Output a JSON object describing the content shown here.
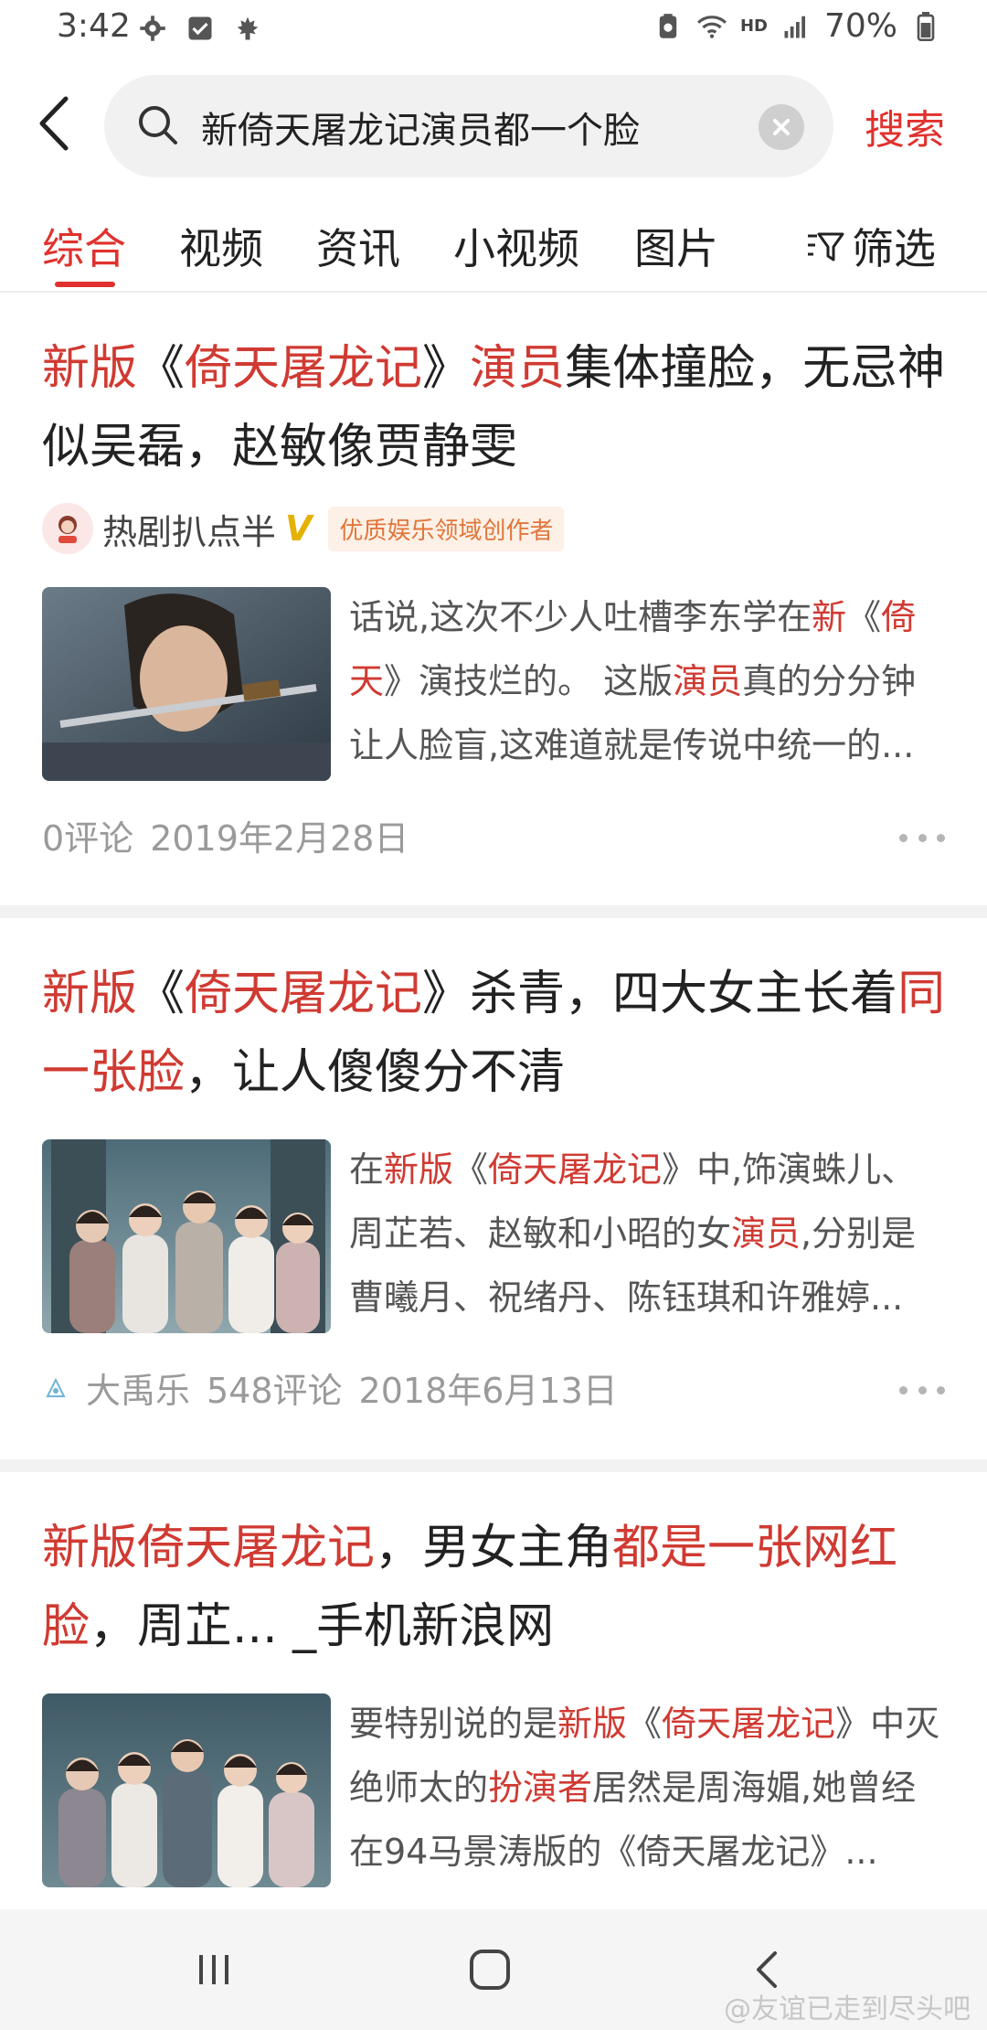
{
  "status_bar": {
    "time": "3:42",
    "battery": "70%",
    "icons_left": [
      "gear-icon",
      "check-icon",
      "leaf-icon"
    ],
    "icons_right": [
      "save-icon",
      "wifi-icon",
      "hd-icon",
      "signal-icon",
      "battery-icon"
    ],
    "hd_label": "HD"
  },
  "search": {
    "query": "新倚天屠龙记演员都一个脸",
    "submit_label": "搜索"
  },
  "tabs": {
    "items": [
      "综合",
      "视频",
      "资讯",
      "小视频",
      "图片"
    ],
    "active": "综合",
    "filter_label": "筛选"
  },
  "results": [
    {
      "title_parts": [
        {
          "text": "新版",
          "hl": true
        },
        {
          "text": "《",
          "hl": false
        },
        {
          "text": "倚天屠龙记",
          "hl": true
        },
        {
          "text": "》",
          "hl": false
        },
        {
          "text": "演员",
          "hl": true
        },
        {
          "text": "集体撞脸，无忌神似吴磊，赵敏像贾静雯",
          "hl": false
        }
      ],
      "author": "热剧扒点半",
      "author_badge": "优质娱乐领域创作者",
      "verified_mark": "V",
      "snippet_parts": [
        {
          "text": "话说,这次不少人吐槽李东学在",
          "hl": false
        },
        {
          "text": "新",
          "hl": true
        },
        {
          "text": "《",
          "hl": false
        },
        {
          "text": "倚天",
          "hl": true
        },
        {
          "text": "》演技烂的。 这版",
          "hl": false
        },
        {
          "text": "演员",
          "hl": true
        },
        {
          "text": "真的分分钟让人脸盲,这难道就是传说中统一的...",
          "hl": false
        }
      ],
      "comments": "0评论",
      "date": "2019年2月28日"
    },
    {
      "title_parts": [
        {
          "text": "新版",
          "hl": true
        },
        {
          "text": "《",
          "hl": false
        },
        {
          "text": "倚天屠龙记",
          "hl": true
        },
        {
          "text": "》杀青，四大女主长着",
          "hl": false
        },
        {
          "text": "同一张脸",
          "hl": true
        },
        {
          "text": "，让人傻傻分不清",
          "hl": false
        }
      ],
      "snippet_parts": [
        {
          "text": "在",
          "hl": false
        },
        {
          "text": "新版",
          "hl": true
        },
        {
          "text": "《",
          "hl": false
        },
        {
          "text": "倚天屠龙记",
          "hl": true
        },
        {
          "text": "》中,饰演蛛儿、周芷若、赵敏和小昭的女",
          "hl": false
        },
        {
          "text": "演员",
          "hl": true
        },
        {
          "text": ",分别是曹曦月、祝绪丹、陈钰琪和许雅婷...",
          "hl": false
        }
      ],
      "source": "大禹乐",
      "comments": "548评论",
      "date": "2018年6月13日"
    },
    {
      "title_parts": [
        {
          "text": "新版倚天屠龙记",
          "hl": true
        },
        {
          "text": "，男女主角",
          "hl": false
        },
        {
          "text": "都是一张网红脸",
          "hl": true
        },
        {
          "text": "，周芷... _手机新浪网",
          "hl": false
        }
      ],
      "snippet_parts": [
        {
          "text": "要特别说的是",
          "hl": false
        },
        {
          "text": "新版",
          "hl": true
        },
        {
          "text": "《",
          "hl": false
        },
        {
          "text": "倚天屠龙记",
          "hl": true
        },
        {
          "text": "》中灭绝师太的",
          "hl": false
        },
        {
          "text": "扮演者",
          "hl": true
        },
        {
          "text": "居然是周海媚,她曾经在94马景涛版的《倚天屠龙记》...",
          "hl": false
        }
      ]
    }
  ],
  "navbar": {
    "buttons": [
      "recent-apps-icon",
      "home-icon",
      "back-icon"
    ],
    "watermark": "@友谊已走到尽头吧"
  },
  "colors": {
    "accent": "#e0312e",
    "highlight": "#d03a32",
    "meta": "#9a9a9a"
  }
}
